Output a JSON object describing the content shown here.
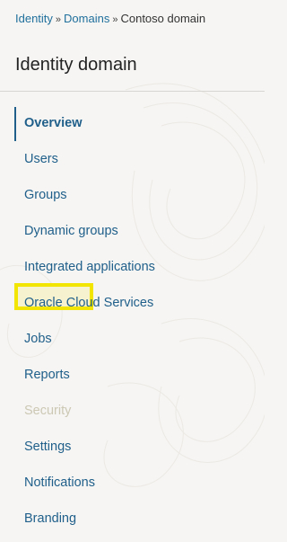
{
  "breadcrumb": {
    "items": [
      {
        "label": "Identity",
        "link": true
      },
      {
        "label": "Domains",
        "link": true
      },
      {
        "label": "Contoso domain",
        "link": false
      }
    ],
    "separator": "»"
  },
  "page_title": "Identity domain",
  "nav": {
    "items": [
      {
        "label": "Overview",
        "active": true
      },
      {
        "label": "Users"
      },
      {
        "label": "Groups"
      },
      {
        "label": "Dynamic groups"
      },
      {
        "label": "Integrated applications"
      },
      {
        "label": "Oracle Cloud Services"
      },
      {
        "label": "Jobs"
      },
      {
        "label": "Reports"
      },
      {
        "label": "Security",
        "highlighted": true
      },
      {
        "label": "Settings"
      },
      {
        "label": "Notifications"
      },
      {
        "label": "Branding"
      }
    ]
  },
  "colors": {
    "link": "#1f6f9c",
    "highlight_border": "#f2e600",
    "background": "#f6f5f3"
  }
}
